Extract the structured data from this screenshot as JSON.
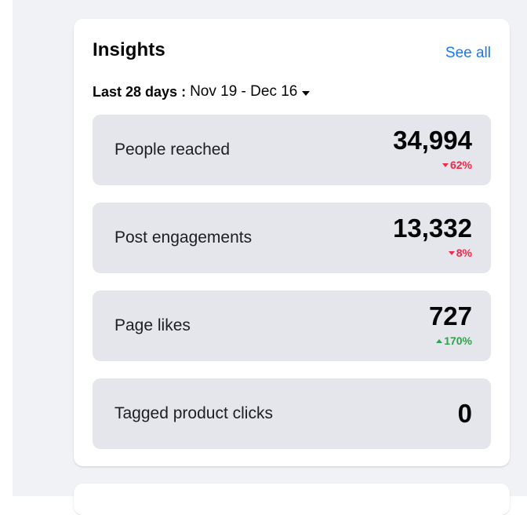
{
  "insights": {
    "title": "Insights",
    "see_all": "See all",
    "date_label": "Last 28 days :",
    "date_range": "Nov 19 - Dec 16",
    "metrics": [
      {
        "label": "People reached",
        "value": "34,994",
        "change": "62%",
        "direction": "down"
      },
      {
        "label": "Post engagements",
        "value": "13,332",
        "change": "8%",
        "direction": "down"
      },
      {
        "label": "Page likes",
        "value": "727",
        "change": "170%",
        "direction": "up"
      },
      {
        "label": "Tagged product clicks",
        "value": "0"
      }
    ]
  },
  "colors": {
    "background": "#f0f2f5",
    "card": "#ffffff",
    "metric_tile": "#e4e6eb",
    "link": "#1877f2",
    "decrease": "#f02849",
    "increase": "#31a24c"
  },
  "icons": {
    "date_dropdown": "caret-down-icon",
    "decrease": "triangle-down-icon",
    "increase": "triangle-up-icon"
  }
}
